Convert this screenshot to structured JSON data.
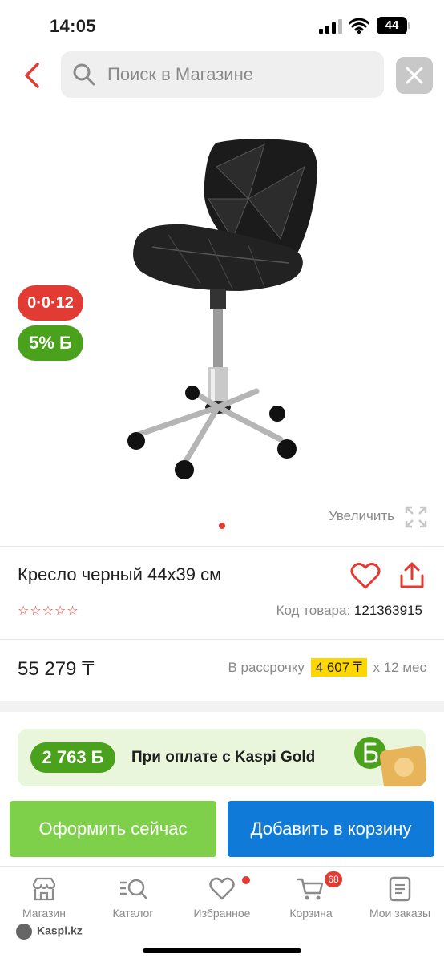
{
  "status_bar": {
    "time": "14:05",
    "battery": "44"
  },
  "search": {
    "placeholder": "Поиск в Магазине"
  },
  "product": {
    "badge_installment": "0·0·12",
    "badge_bonus": "5% Б",
    "zoom_label": "Увеличить",
    "title": "Кресло черный 44x39 см",
    "rating_stars": "☆☆☆☆☆",
    "code_label": "Код товара:",
    "code_value": "121363915",
    "price": "55 279 ₸",
    "installment_prefix": "В рассрочку",
    "installment_amount": "4 607 ₸",
    "installment_suffix": "x 12 мес"
  },
  "promo": {
    "bonus": "2 763 Б",
    "text": "При оплате с Kaspi Gold"
  },
  "buttons": {
    "checkout": "Оформить сейчас",
    "add_to_cart": "Добавить в корзину"
  },
  "nav": {
    "items": [
      {
        "label": "Магазин",
        "icon": "store-icon"
      },
      {
        "label": "Каталог",
        "icon": "catalog-search-icon"
      },
      {
        "label": "Избранное",
        "icon": "heart-icon"
      },
      {
        "label": "Корзина",
        "icon": "cart-icon"
      },
      {
        "label": "Мои заказы",
        "icon": "orders-icon"
      }
    ],
    "cart_count": "68"
  },
  "watermark": "Kaspi.kz",
  "colors": {
    "accent_red": "#e23b34",
    "green": "#4aa21c",
    "blue": "#0f7ad8",
    "light_green": "#7ed04a",
    "highlight": "#ffd600"
  }
}
